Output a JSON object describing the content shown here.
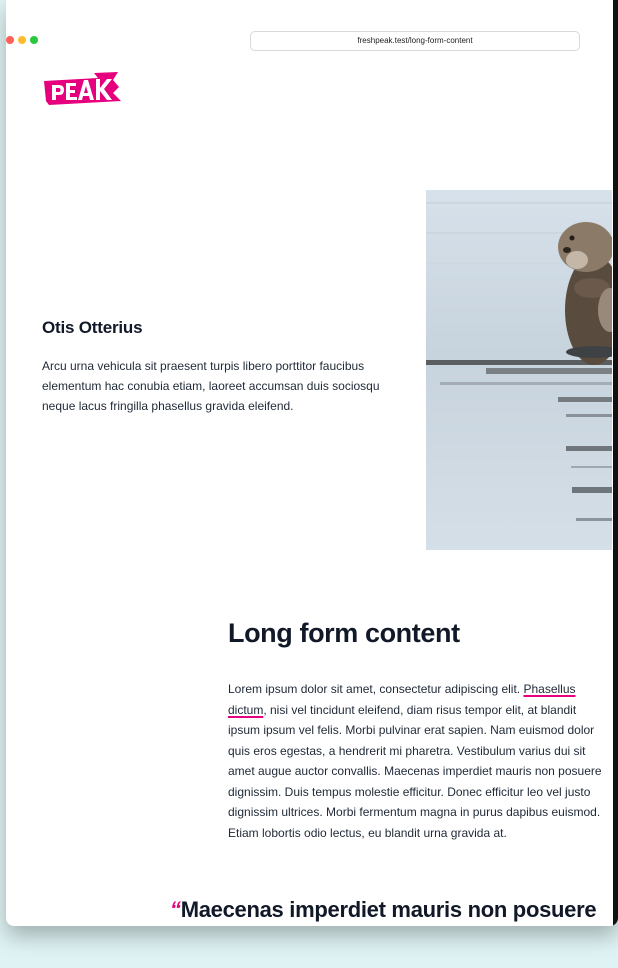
{
  "browser": {
    "url": "freshpeak.test/long-form-content"
  },
  "logo": {
    "text": "PEAK",
    "color": "#e6007e"
  },
  "profile": {
    "name": "Otis Otterius",
    "bio": "Arcu urna vehicula sit praesent turpis libero porttitor faucibus elementum hac conubia etiam, laoreet accumsan duis sociosqu neque lacus fringilla phasellus gravida eleifend."
  },
  "article": {
    "title": "Long form content",
    "body_before_link": "Lorem ipsum dolor sit amet, consectetur adipiscing elit. ",
    "link_text": "Phasellus dictum",
    "body_after_link": ", nisi vel tincidunt eleifend, diam risus tempor elit, at blandit ipsum ipsum vel felis. Morbi pulvinar erat sapien. Nam euismod dolor quis eros egestas, a hendrerit mi pharetra. Vestibulum varius dui sit amet augue auctor convallis. Maecenas imperdiet mauris non posuere dignissim. Duis tempus molestie efficitur. Donec efficitur leo vel justo dignissim ultrices. Morbi fermentum magna in purus dapibus euismod. Etiam lobortis odio lectus, eu blandit urna gravida at.",
    "quote_mark": "“",
    "quote": "Maecenas imperdiet mauris non posuere"
  },
  "colors": {
    "accent": "#e6007e",
    "text": "#111827",
    "background": "#dff3f4"
  }
}
